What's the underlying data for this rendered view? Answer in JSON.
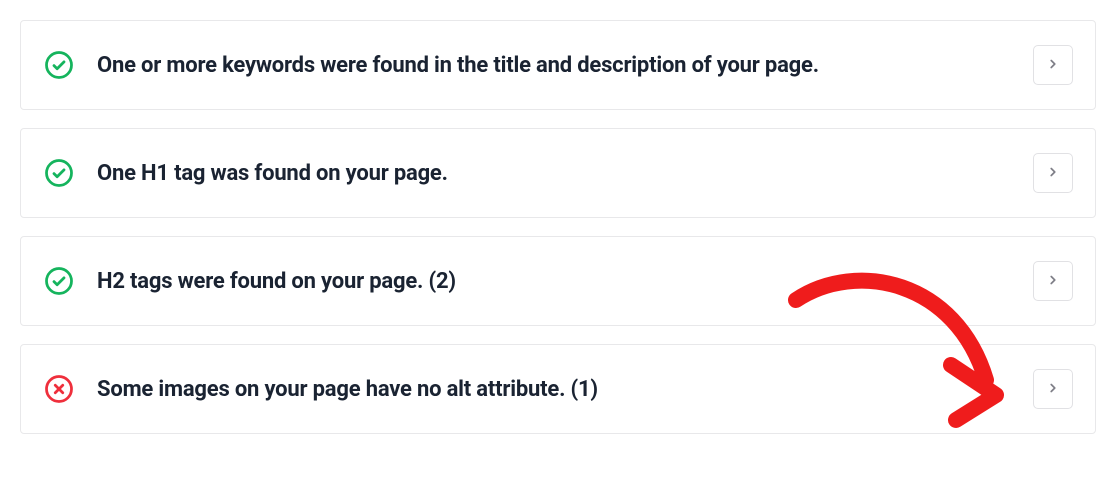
{
  "audit": {
    "items": [
      {
        "status": "pass",
        "message": "One or more keywords were found in the title and description of your page."
      },
      {
        "status": "pass",
        "message": "One H1 tag was found on your page."
      },
      {
        "status": "pass",
        "message": "H2 tags were found on your page. (2)"
      },
      {
        "status": "fail",
        "message": "Some images on your page have no alt attribute. (1)"
      }
    ]
  },
  "colors": {
    "pass": "#15b45d",
    "fail": "#ef2f3c",
    "chevron": "#7e7e87",
    "annotation": "#ef1c1c"
  }
}
